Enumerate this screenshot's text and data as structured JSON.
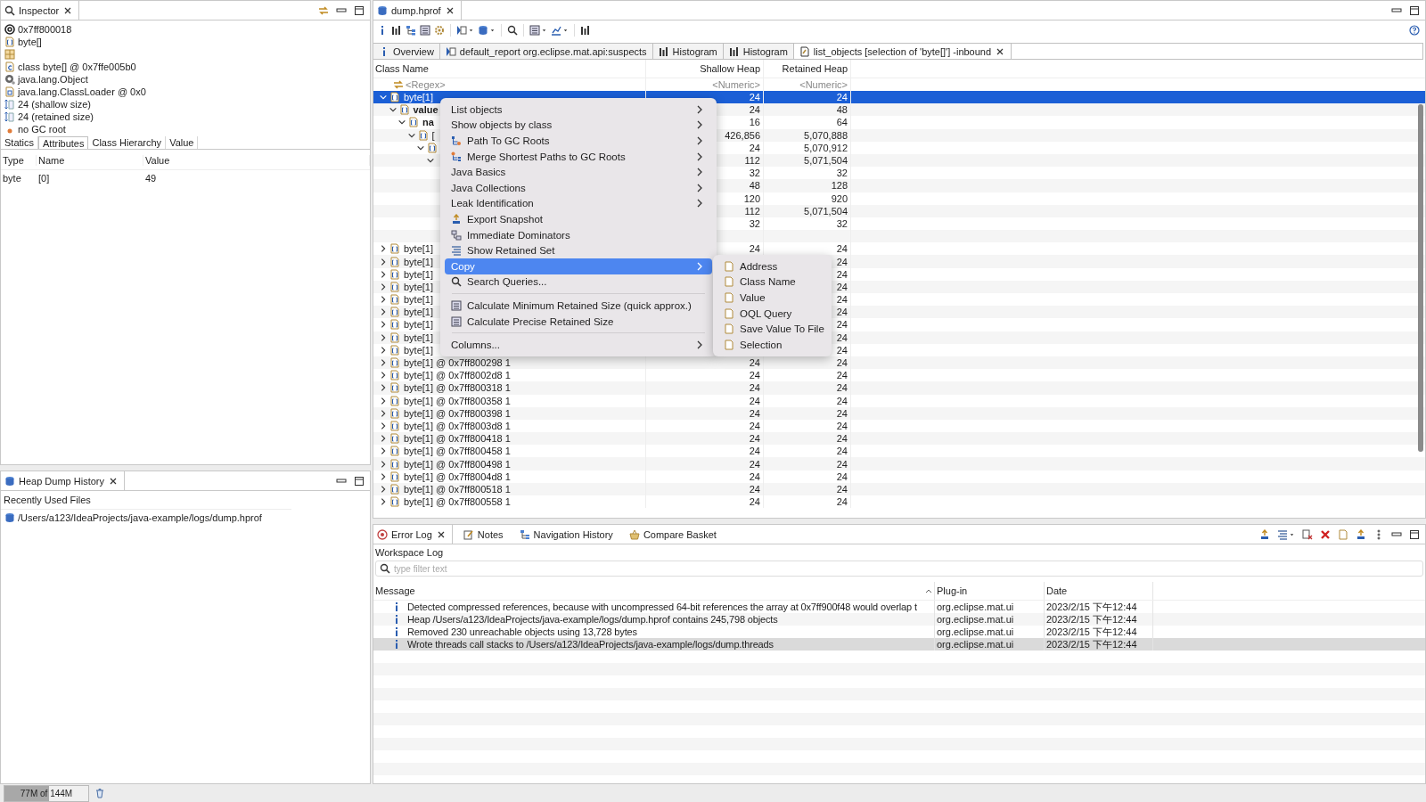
{
  "inspector": {
    "tab": "Inspector",
    "items": [
      {
        "kind": "address",
        "text": "0x7ff800018"
      },
      {
        "kind": "array",
        "text": "byte[]"
      },
      {
        "kind": "field"
      },
      {
        "kind": "class",
        "text": "class byte[] @ 0x7ffe005b0"
      },
      {
        "kind": "superclass",
        "text": "java.lang.Object"
      },
      {
        "kind": "loader",
        "text": "java.lang.ClassLoader @ 0x0"
      },
      {
        "kind": "size",
        "text": "24 (shallow size)"
      },
      {
        "kind": "size",
        "text": "24 (retained size)"
      },
      {
        "kind": "root",
        "text": "no GC root"
      }
    ],
    "tabs": [
      {
        "label": "Statics",
        "selected": false
      },
      {
        "label": "Attributes",
        "selected": true
      },
      {
        "label": "Class Hierarchy",
        "selected": false
      },
      {
        "label": "Value",
        "selected": false
      }
    ],
    "table": {
      "columns": [
        "Type",
        "Name",
        "Value"
      ],
      "rows": [
        [
          "byte",
          "[0]",
          "49"
        ]
      ]
    }
  },
  "history": {
    "tab": "Heap Dump History",
    "header": "Recently Used Files",
    "files": [
      "/Users/a123/IdeaProjects/java-example/logs/dump.hprof"
    ]
  },
  "status_bar": {
    "memory": "77M of 144M",
    "level": 0.53
  },
  "editor": {
    "tab": "dump.hprof",
    "tabs": [
      {
        "kind": "info",
        "label": "Overview",
        "selected": false
      },
      {
        "kind": "report",
        "label": "default_report  org.eclipse.mat.api:suspects",
        "selected": false
      },
      {
        "kind": "histogram",
        "label": "Histogram",
        "selected": false
      },
      {
        "kind": "histogram",
        "label": "Histogram",
        "selected": false
      },
      {
        "kind": "query",
        "label": "list_objects  [selection of 'byte[]'] -inbound",
        "selected": true
      }
    ],
    "tree": {
      "columns": [
        "Class Name",
        "Shallow Heap",
        "Retained Heap"
      ],
      "filters": [
        "<Regex>",
        "<Numeric>",
        "<Numeric>"
      ],
      "rows": [
        {
          "kind": "object",
          "name": "byte[1]",
          "shallow": "24",
          "retained": "24",
          "expanded": true,
          "selected": true,
          "children": [
            {
              "kind": "field",
              "name": "value",
              "shallow": "24",
              "retained": "48",
              "expanded": true,
              "selected": false,
              "children": [
                {
                  "kind": "field",
                  "name": "na",
                  "shallow": "16",
                  "retained": "64",
                  "expanded": true,
                  "selected": false,
                  "children": [
                    {
                      "kind": "object",
                      "name": "[",
                      "shallow": "426,856",
                      "retained": "5,070,888",
                      "expanded": true,
                      "selected": false,
                      "children": [
                        {
                          "kind": "object",
                          "icon": true,
                          "shallow": "24",
                          "retained": "5,070,912",
                          "expanded": true,
                          "selected": false,
                          "children": [
                            {
                              "kind": "object",
                              "shallow": "112",
                              "retained": "5,071,504",
                              "expanded": true,
                              "selected": false,
                              "children": [
                                {
                                  "kind": "object",
                                  "shallow": "32",
                                  "retained": "32",
                                  "selected": false
                                },
                                {
                                  "kind": "object",
                                  "shallow": "48",
                                  "retained": "128",
                                  "selected": false
                                },
                                {
                                  "kind": "object",
                                  "shallow": "120",
                                  "retained": "920",
                                  "selected": false
                                },
                                {
                                  "kind": "object",
                                  "shallow": "112",
                                  "retained": "5,071,504",
                                  "selected": false
                                },
                                {
                                  "kind": "object",
                                  "shallow": "32",
                                  "retained": "32",
                                  "selected": false
                                }
                              ]
                            }
                          ]
                        }
                      ]
                    }
                  ]
                }
              ]
            },
            {
              "kind": "blank",
              "selected": false
            }
          ]
        },
        {
          "kind": "object",
          "name": "byte[1]",
          "shallow": "24",
          "retained": "24",
          "expanded": false,
          "selected": false
        },
        {
          "kind": "object",
          "name": "byte[1]",
          "retained": "24",
          "expanded": false,
          "selected": false
        },
        {
          "kind": "object",
          "name": "byte[1]",
          "retained": "24",
          "expanded": false,
          "selected": false
        },
        {
          "kind": "object",
          "name": "byte[1]",
          "retained": "24",
          "expanded": false,
          "selected": false
        },
        {
          "kind": "object",
          "name": "byte[1]",
          "retained": "24",
          "expanded": false,
          "selected": false
        },
        {
          "kind": "object",
          "name": "byte[1]",
          "retained": "24",
          "expanded": false,
          "selected": false
        },
        {
          "kind": "object",
          "name": "byte[1]",
          "retained": "24",
          "expanded": false,
          "selected": false
        },
        {
          "kind": "object",
          "name": "byte[1]",
          "retained": "24",
          "expanded": false,
          "selected": false
        },
        {
          "kind": "object",
          "name": "byte[1]",
          "retained": "24",
          "expanded": false,
          "selected": false
        },
        {
          "kind": "object",
          "name": "byte[1] @ 0x7ff800298  1",
          "shallow": "24",
          "retained": "24",
          "expanded": false,
          "selected": false
        },
        {
          "kind": "object",
          "name": "byte[1] @ 0x7ff8002d8  1",
          "shallow": "24",
          "retained": "24",
          "expanded": false,
          "selected": false
        },
        {
          "kind": "object",
          "name": "byte[1] @ 0x7ff800318  1",
          "shallow": "24",
          "retained": "24",
          "expanded": false,
          "selected": false
        },
        {
          "kind": "object",
          "name": "byte[1] @ 0x7ff800358  1",
          "shallow": "24",
          "retained": "24",
          "expanded": false,
          "selected": false
        },
        {
          "kind": "object",
          "name": "byte[1] @ 0x7ff800398  1",
          "shallow": "24",
          "retained": "24",
          "expanded": false,
          "selected": false
        },
        {
          "kind": "object",
          "name": "byte[1] @ 0x7ff8003d8  1",
          "shallow": "24",
          "retained": "24",
          "expanded": false,
          "selected": false
        },
        {
          "kind": "object",
          "name": "byte[1] @ 0x7ff800418  1",
          "shallow": "24",
          "retained": "24",
          "expanded": false,
          "selected": false
        },
        {
          "kind": "object",
          "name": "byte[1] @ 0x7ff800458  1",
          "shallow": "24",
          "retained": "24",
          "expanded": false,
          "selected": false
        },
        {
          "kind": "object",
          "name": "byte[1] @ 0x7ff800498  1",
          "shallow": "24",
          "retained": "24",
          "expanded": false,
          "selected": false
        },
        {
          "kind": "object",
          "name": "byte[1] @ 0x7ff8004d8  1",
          "shallow": "24",
          "retained": "24",
          "expanded": false,
          "selected": false
        },
        {
          "kind": "object",
          "name": "byte[1] @ 0x7ff800518  1",
          "shallow": "24",
          "retained": "24",
          "expanded": false,
          "selected": false
        },
        {
          "kind": "object",
          "name": "byte[1] @ 0x7ff800558  1",
          "shallow": "24",
          "retained": "24",
          "expanded": false,
          "selected": false
        }
      ]
    }
  },
  "context_menu": {
    "items": [
      {
        "kind": "plain",
        "label": "List objects",
        "submenu": true,
        "selected": false
      },
      {
        "kind": "plain",
        "label": "Show objects by class",
        "submenu": true,
        "selected": false
      },
      {
        "kind": "path",
        "label": "Path To GC Roots",
        "submenu": true,
        "selected": false
      },
      {
        "kind": "merge",
        "label": "Merge Shortest Paths to GC Roots",
        "submenu": true,
        "selected": false
      },
      {
        "kind": "plain",
        "label": "Java Basics",
        "submenu": true,
        "selected": false
      },
      {
        "kind": "plain",
        "label": "Java Collections",
        "submenu": true,
        "selected": false
      },
      {
        "kind": "plain",
        "label": "Leak Identification",
        "submenu": true,
        "selected": false
      },
      {
        "kind": "export",
        "label": "Export Snapshot",
        "submenu": false,
        "selected": false
      },
      {
        "kind": "dominators",
        "label": "Immediate Dominators",
        "submenu": false,
        "selected": false
      },
      {
        "kind": "retained",
        "label": "Show Retained Set",
        "submenu": false,
        "selected": false
      },
      {
        "kind": "plain",
        "label": "Copy",
        "submenu": true,
        "selected": true
      },
      {
        "kind": "search",
        "label": "Search Queries...",
        "submenu": false,
        "selected": false
      },
      {
        "kind": "separator"
      },
      {
        "kind": "calc",
        "label": "Calculate Minimum Retained Size (quick approx.)",
        "submenu": false,
        "selected": false
      },
      {
        "kind": "calc",
        "label": "Calculate Precise Retained Size",
        "submenu": false,
        "selected": false
      },
      {
        "kind": "separator"
      },
      {
        "kind": "plain",
        "label": "Columns...",
        "submenu": true,
        "selected": false
      }
    ],
    "submenu": [
      "Address",
      "Class Name",
      "Value",
      "OQL Query",
      "Save Value To File",
      "Selection"
    ]
  },
  "log": {
    "tabs": [
      {
        "kind": "error",
        "label": "Error Log",
        "selected": true
      },
      {
        "kind": "notes",
        "label": "Notes",
        "selected": false
      },
      {
        "kind": "navigation",
        "label": "Navigation History",
        "selected": false
      },
      {
        "kind": "basket",
        "label": "Compare Basket",
        "selected": false
      }
    ],
    "title": "Workspace Log",
    "filter": {
      "placeholder": "type filter text"
    },
    "columns": [
      "Message",
      "Plug-in",
      "Date"
    ],
    "rows": [
      {
        "message": "Detected compressed references, because with uncompressed 64-bit references the array at 0x7ff900f48 would overlap t",
        "plugin": "org.eclipse.mat.ui",
        "date": "2023/2/15 下午12:44",
        "selected": false
      },
      {
        "message": "Heap /Users/a123/IdeaProjects/java-example/logs/dump.hprof contains 245,798 objects",
        "plugin": "org.eclipse.mat.ui",
        "date": "2023/2/15 下午12:44",
        "selected": false
      },
      {
        "message": "Removed 230 unreachable objects using 13,728 bytes",
        "plugin": "org.eclipse.mat.ui",
        "date": "2023/2/15 下午12:44",
        "selected": false
      },
      {
        "message": "Wrote threads call stacks to /Users/a123/IdeaProjects/java-example/logs/dump.threads",
        "plugin": "org.eclipse.mat.ui",
        "date": "2023/2/15 下午12:44",
        "selected": true
      }
    ]
  }
}
